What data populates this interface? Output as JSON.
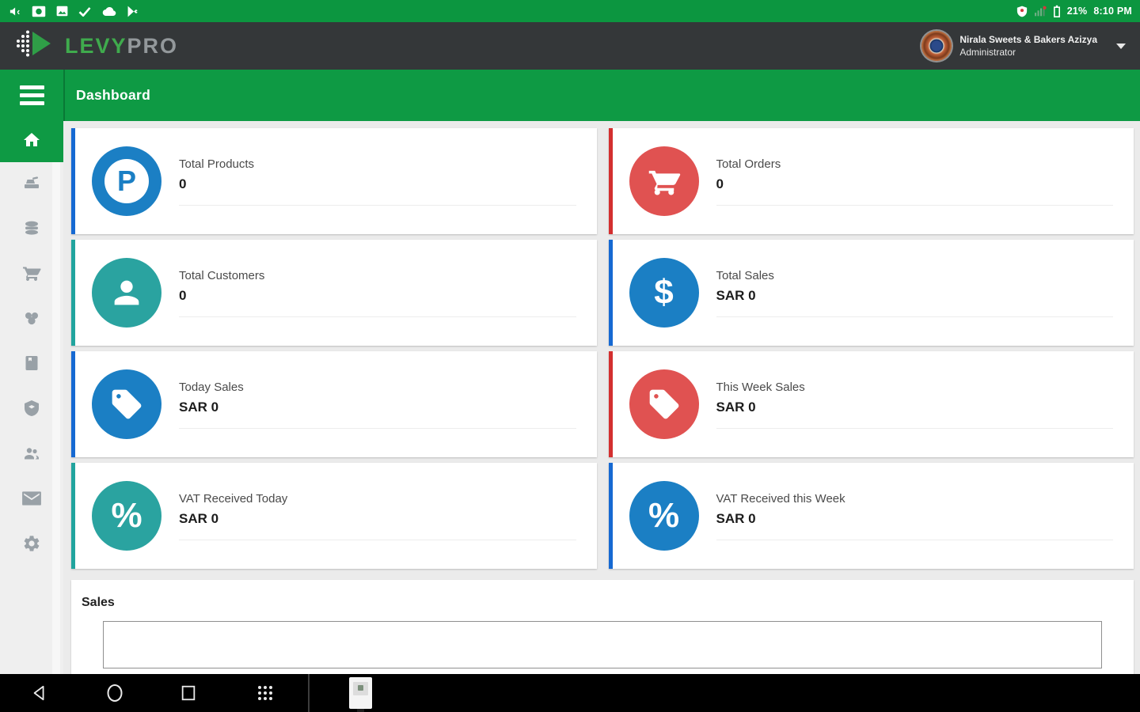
{
  "status_bar": {
    "time": "8:10 PM",
    "battery_percent": "21%",
    "left_icons": [
      "announcement-icon",
      "screenshot-icon",
      "image-icon",
      "check-icon",
      "cloud-icon",
      "play-store-icon"
    ],
    "right_icons": [
      "vpn-shield-icon",
      "signal-icon",
      "battery-icon"
    ]
  },
  "app_bar": {
    "brand": {
      "levy": "LEVY",
      "pro": "PRO"
    },
    "account": {
      "name": "Nirala Sweets & Bakers Azizya",
      "role": "Administrator"
    }
  },
  "title_bar": {
    "title": "Dashboard"
  },
  "sidebar": {
    "items": [
      {
        "icon": "home-icon",
        "active": true
      },
      {
        "icon": "pos-terminal-icon",
        "active": false
      },
      {
        "icon": "products-icon",
        "active": false
      },
      {
        "icon": "cart-icon",
        "active": false
      },
      {
        "icon": "categories-icon",
        "active": false
      },
      {
        "icon": "orders-book-icon",
        "active": false
      },
      {
        "icon": "inventory-icon",
        "active": false
      },
      {
        "icon": "customers-icon",
        "active": false
      },
      {
        "icon": "messages-icon",
        "active": false
      },
      {
        "icon": "settings-icon",
        "active": false
      }
    ]
  },
  "cards": [
    {
      "label": "Total Products",
      "value": "0",
      "icon": "letter-p-icon",
      "glyph": "P",
      "color": "blue"
    },
    {
      "label": "Total Orders",
      "value": "0",
      "icon": "cart-icon",
      "color": "red"
    },
    {
      "label": "Total Customers",
      "value": "0",
      "icon": "person-icon",
      "color": "teal"
    },
    {
      "label": "Total Sales",
      "value": "SAR 0",
      "icon": "dollar-icon",
      "glyph": "$",
      "color": "blue"
    },
    {
      "label": "Today Sales",
      "value": "SAR 0",
      "icon": "tag-icon",
      "color": "blue"
    },
    {
      "label": "This Week Sales",
      "value": "SAR 0",
      "icon": "tag-icon",
      "color": "red"
    },
    {
      "label": "VAT Received Today",
      "value": "SAR 0",
      "icon": "percent-icon",
      "glyph": "%",
      "color": "teal"
    },
    {
      "label": "VAT Received this Week",
      "value": "SAR 0",
      "icon": "percent-icon",
      "glyph": "%",
      "color": "blue"
    }
  ],
  "sales_section": {
    "title": "Sales"
  },
  "nav_bar": {
    "icons": [
      "back-icon",
      "home-circle-icon",
      "recents-icon",
      "apps-grid-icon",
      "app-thumbnail"
    ]
  },
  "colors": {
    "status_bar_green": "#0c9640",
    "title_bar_green": "#0e9a44",
    "app_bar_dark": "#343739",
    "blue_accent": "#1669d2",
    "blue_circle": "#1b7fc4",
    "red_accent": "#d32f2f",
    "red_circle": "#e05251",
    "teal_accent": "#21a49e",
    "teal_circle": "#2aa3a0",
    "brand_green": "#3fab4d",
    "brand_gray": "#93989b"
  }
}
